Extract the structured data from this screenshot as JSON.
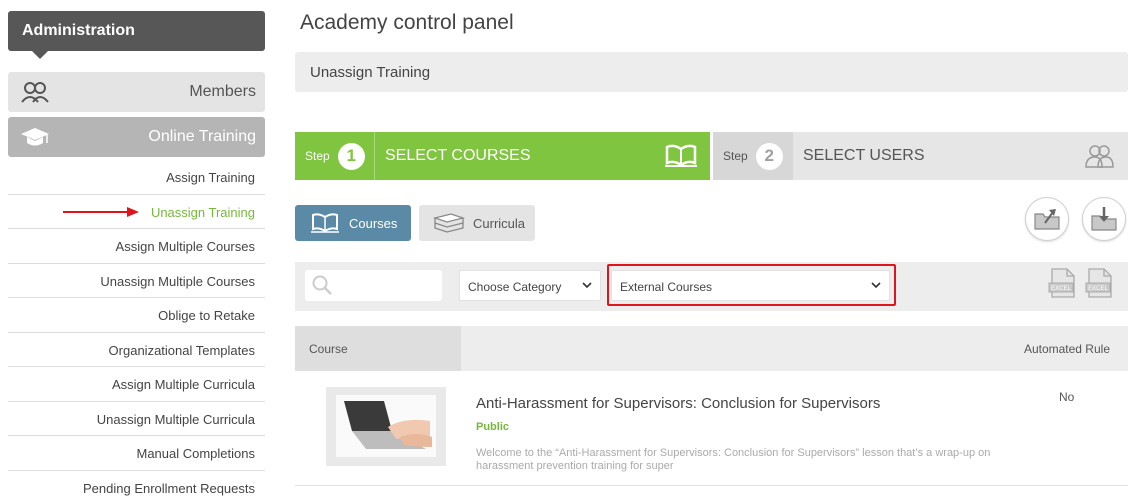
{
  "sidebar": {
    "header": "Administration",
    "members_label": "Members",
    "online_training_label": "Online Training",
    "items": [
      {
        "label": "Assign Training"
      },
      {
        "label": "Unassign Training"
      },
      {
        "label": "Assign Multiple Courses"
      },
      {
        "label": "Unassign Multiple Courses"
      },
      {
        "label": "Oblige to Retake"
      },
      {
        "label": "Organizational Templates"
      },
      {
        "label": "Assign Multiple Curricula"
      },
      {
        "label": "Unassign Multiple Curricula"
      },
      {
        "label": "Manual Completions"
      },
      {
        "label": "Pending Enrollment Requests"
      }
    ],
    "active_index": 1
  },
  "main": {
    "page_title": "Academy control panel",
    "breadcrumb": "Unassign Training",
    "steps": [
      {
        "prefix": "Step",
        "number": "1",
        "label": "SELECT COURSES"
      },
      {
        "prefix": "Step",
        "number": "2",
        "label": "SELECT USERS"
      }
    ],
    "tabs": {
      "courses": "Courses",
      "curricula": "Curricula"
    },
    "filters": {
      "search_placeholder": "",
      "category_value": "Choose Category",
      "course_type_value": "External Courses"
    },
    "table": {
      "col_course": "Course",
      "col_rule": "Automated Rule",
      "rows": [
        {
          "title": "Anti-Harassment for Supervisors: Conclusion for Supervisors",
          "visibility": "Public",
          "description": "Welcome to the “Anti-Harassment for Supervisors: Conclusion for Supervisors” lesson that’s a wrap-up on harassment prevention training for super",
          "automated_rule": "No"
        }
      ]
    }
  },
  "colors": {
    "accent_green": "#80c53f",
    "active_tab_blue": "#5b8aa6",
    "highlight_red": "#e0141c",
    "sidebar_dark": "#575757"
  }
}
